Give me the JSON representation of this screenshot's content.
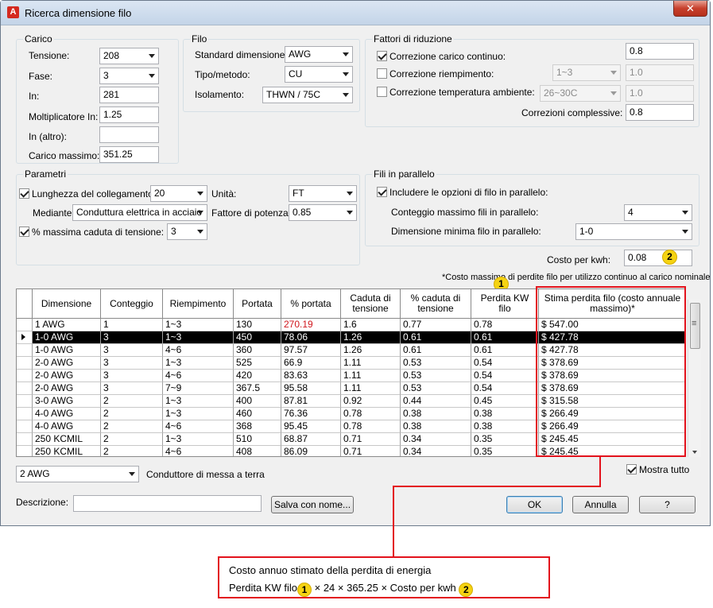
{
  "window": {
    "title": "Ricerca dimensione filo",
    "close": "✕",
    "app_icon": "A"
  },
  "carico": {
    "title": "Carico",
    "tensione_label": "Tensione:",
    "tensione_value": "208",
    "fase_label": "Fase:",
    "fase_value": "3",
    "in_label": "In:",
    "in_value": "281",
    "molt_label": "Moltiplicatore In:",
    "molt_value": "1.25",
    "in_altro_label": "In (altro):",
    "in_altro_value": "",
    "carico_max_label": "Carico massimo:",
    "carico_max_value": "351.25"
  },
  "filo": {
    "title": "Filo",
    "standard_label": "Standard dimensione:",
    "standard_value": "AWG",
    "tipo_label": "Tipo/metodo:",
    "tipo_value": "CU",
    "isolamento_label": "Isolamento:",
    "isolamento_value": "THWN / 75C"
  },
  "fattori": {
    "title": "Fattori di riduzione",
    "carico_continuo_label": "Correzione carico continuo:",
    "carico_continuo_checked": true,
    "carico_continuo_value": "0.8",
    "riempimento_label": "Correzione riempimento:",
    "riempimento_checked": false,
    "riempimento_combo": "1~3",
    "riempimento_value": "1.0",
    "temperatura_label": "Correzione temperatura ambiente:",
    "temperatura_checked": false,
    "temperatura_combo": "26~30C",
    "temperatura_value": "1.0",
    "complessive_label": "Correzioni complessive:",
    "complessive_value": "0.8"
  },
  "parametri": {
    "title": "Parametri",
    "lunghezza_label": "Lunghezza del collegamento:",
    "lunghezza_checked": true,
    "lunghezza_value": "20",
    "unita_label": "Unità:",
    "unita_value": "FT",
    "mediante_label": "Mediante:",
    "mediante_value": "Conduttura elettrica in acciaio",
    "fattore_label": "Fattore di potenza:",
    "fattore_value": "0.85",
    "caduta_label": "% massima caduta di tensione:",
    "caduta_checked": true,
    "caduta_value": "3"
  },
  "paralleli": {
    "title": "Fili in parallelo",
    "includere_label": "Includere le opzioni di filo in parallelo:",
    "includere_checked": true,
    "conteggio_label": "Conteggio massimo fili in parallelo:",
    "conteggio_value": "4",
    "dimensione_label": "Dimensione minima filo in parallelo:",
    "dimensione_value": "1-0"
  },
  "costo": {
    "label": "Costo per kwh:",
    "value": "0.08"
  },
  "note": "*Costo massimo di perdite filo per utilizzo continuo al carico nominale",
  "table": {
    "headers": [
      "Dimensione",
      "Conteggio",
      "Riempimento",
      "Portata",
      "% portata",
      "Caduta di tensione",
      "% caduta di tensione",
      "Perdita KW filo",
      "Stima perdita filo (costo annuale massimo)*"
    ],
    "rows": [
      [
        "1 AWG",
        "1",
        "1~3",
        "130",
        "270.19",
        "1.6",
        "0.77",
        "0.78",
        "$ 547.00"
      ],
      [
        "1-0 AWG",
        "3",
        "1~3",
        "450",
        "78.06",
        "1.26",
        "0.61",
        "0.61",
        "$ 427.78"
      ],
      [
        "1-0 AWG",
        "3",
        "4~6",
        "360",
        "97.57",
        "1.26",
        "0.61",
        "0.61",
        "$ 427.78"
      ],
      [
        "2-0 AWG",
        "3",
        "1~3",
        "525",
        "66.9",
        "1.11",
        "0.53",
        "0.54",
        "$ 378.69"
      ],
      [
        "2-0 AWG",
        "3",
        "4~6",
        "420",
        "83.63",
        "1.11",
        "0.53",
        "0.54",
        "$ 378.69"
      ],
      [
        "2-0 AWG",
        "3",
        "7~9",
        "367.5",
        "95.58",
        "1.11",
        "0.53",
        "0.54",
        "$ 378.69"
      ],
      [
        "3-0 AWG",
        "2",
        "1~3",
        "400",
        "87.81",
        "0.92",
        "0.44",
        "0.45",
        "$ 315.58"
      ],
      [
        "4-0 AWG",
        "2",
        "1~3",
        "460",
        "76.36",
        "0.78",
        "0.38",
        "0.38",
        "$ 266.49"
      ],
      [
        "4-0 AWG",
        "2",
        "4~6",
        "368",
        "95.45",
        "0.78",
        "0.38",
        "0.38",
        "$ 266.49"
      ],
      [
        "250 KCMIL",
        "2",
        "1~3",
        "510",
        "68.87",
        "0.71",
        "0.34",
        "0.35",
        "$ 245.45"
      ],
      [
        "250 KCMIL",
        "2",
        "4~6",
        "408",
        "86.09",
        "0.71",
        "0.34",
        "0.35",
        "$ 245.45"
      ]
    ],
    "selected_row": 1,
    "highlight_color": "#d0161c"
  },
  "terra": {
    "value": "2 AWG",
    "label": "Conduttore di messa a terra"
  },
  "mostra_tutto": {
    "label": "Mostra tutto",
    "checked": true
  },
  "descrizione": {
    "label": "Descrizione:",
    "value": ""
  },
  "buttons": {
    "salva": "Salva con nome...",
    "ok": "OK",
    "annulla": "Annulla",
    "help": "?"
  },
  "badges": {
    "one": "1",
    "two": "2"
  },
  "callout": {
    "line1": "Costo annuo stimato della perdita di energia",
    "line2_a": "Perdita KW filo",
    "line2_b": "× 24 × 365.25 × Costo per kwh"
  },
  "colors": {
    "annotation_red": "#e3121c",
    "badge_yellow": "#f5d312",
    "selection": "#000000"
  }
}
